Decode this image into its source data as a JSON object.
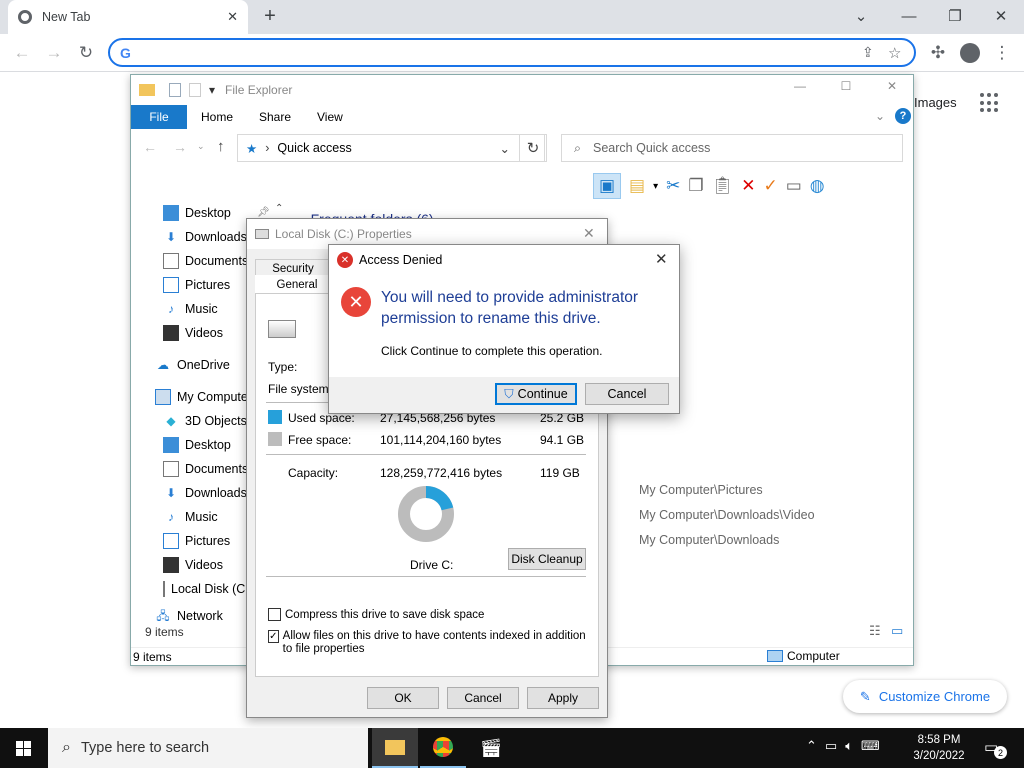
{
  "browser": {
    "tab_title": "New Tab",
    "omnibox_value": "",
    "ntp_images_label": "Images",
    "customize_label": "Customize Chrome"
  },
  "explorer": {
    "title": "File Explorer",
    "ribbon_tabs": [
      "File",
      "Home",
      "Share",
      "View"
    ],
    "address": "Quick access",
    "search_placeholder": "Search Quick access",
    "nav_items": [
      "Desktop",
      "Downloads",
      "Documents",
      "Pictures",
      "Music",
      "Videos",
      "OneDrive",
      "My Computer",
      "3D Objects",
      "Desktop",
      "Documents",
      "Downloads",
      "Music",
      "Pictures",
      "Videos",
      "Local Disk (C:)",
      "Network"
    ],
    "frequent_header": "Frequent folders (6)",
    "recent_paths": [
      "My Computer\\Pictures",
      "My Computer\\Downloads\\Video",
      "My Computer\\Downloads"
    ],
    "items_count": "9 items",
    "status_items": "9 items",
    "status_location": "Computer"
  },
  "properties": {
    "title": "Local Disk (C:) Properties",
    "tab_security": "Security",
    "tab_general": "General",
    "type_label": "Type:",
    "filesystem_label": "File system:",
    "used_label": "Used space:",
    "used_bytes": "27,145,568,256 bytes",
    "used_gb": "25.2 GB",
    "free_label": "Free space:",
    "free_bytes": "101,114,204,160 bytes",
    "free_gb": "94.1 GB",
    "capacity_label": "Capacity:",
    "capacity_bytes": "128,259,772,416 bytes",
    "capacity_gb": "119 GB",
    "used_fraction": 0.212,
    "drive_label": "Drive C:",
    "cleanup_button": "Disk Cleanup",
    "compress_label": "Compress this drive to save disk space",
    "index_label": "Allow files on this drive to have contents indexed in addition to file properties",
    "ok": "OK",
    "cancel": "Cancel",
    "apply": "Apply",
    "used_color": "#26a0da",
    "free_color": "#bcbcbc"
  },
  "dialog": {
    "title": "Access Denied",
    "main_text": "You will need to provide administrator permission to rename this drive.",
    "sub_text": "Click Continue to complete this operation.",
    "continue_button": "Continue",
    "cancel_button": "Cancel"
  },
  "taskbar": {
    "search_placeholder": "Type here to search",
    "time": "8:58 PM",
    "date": "3/20/2022",
    "notification_count": "2"
  }
}
